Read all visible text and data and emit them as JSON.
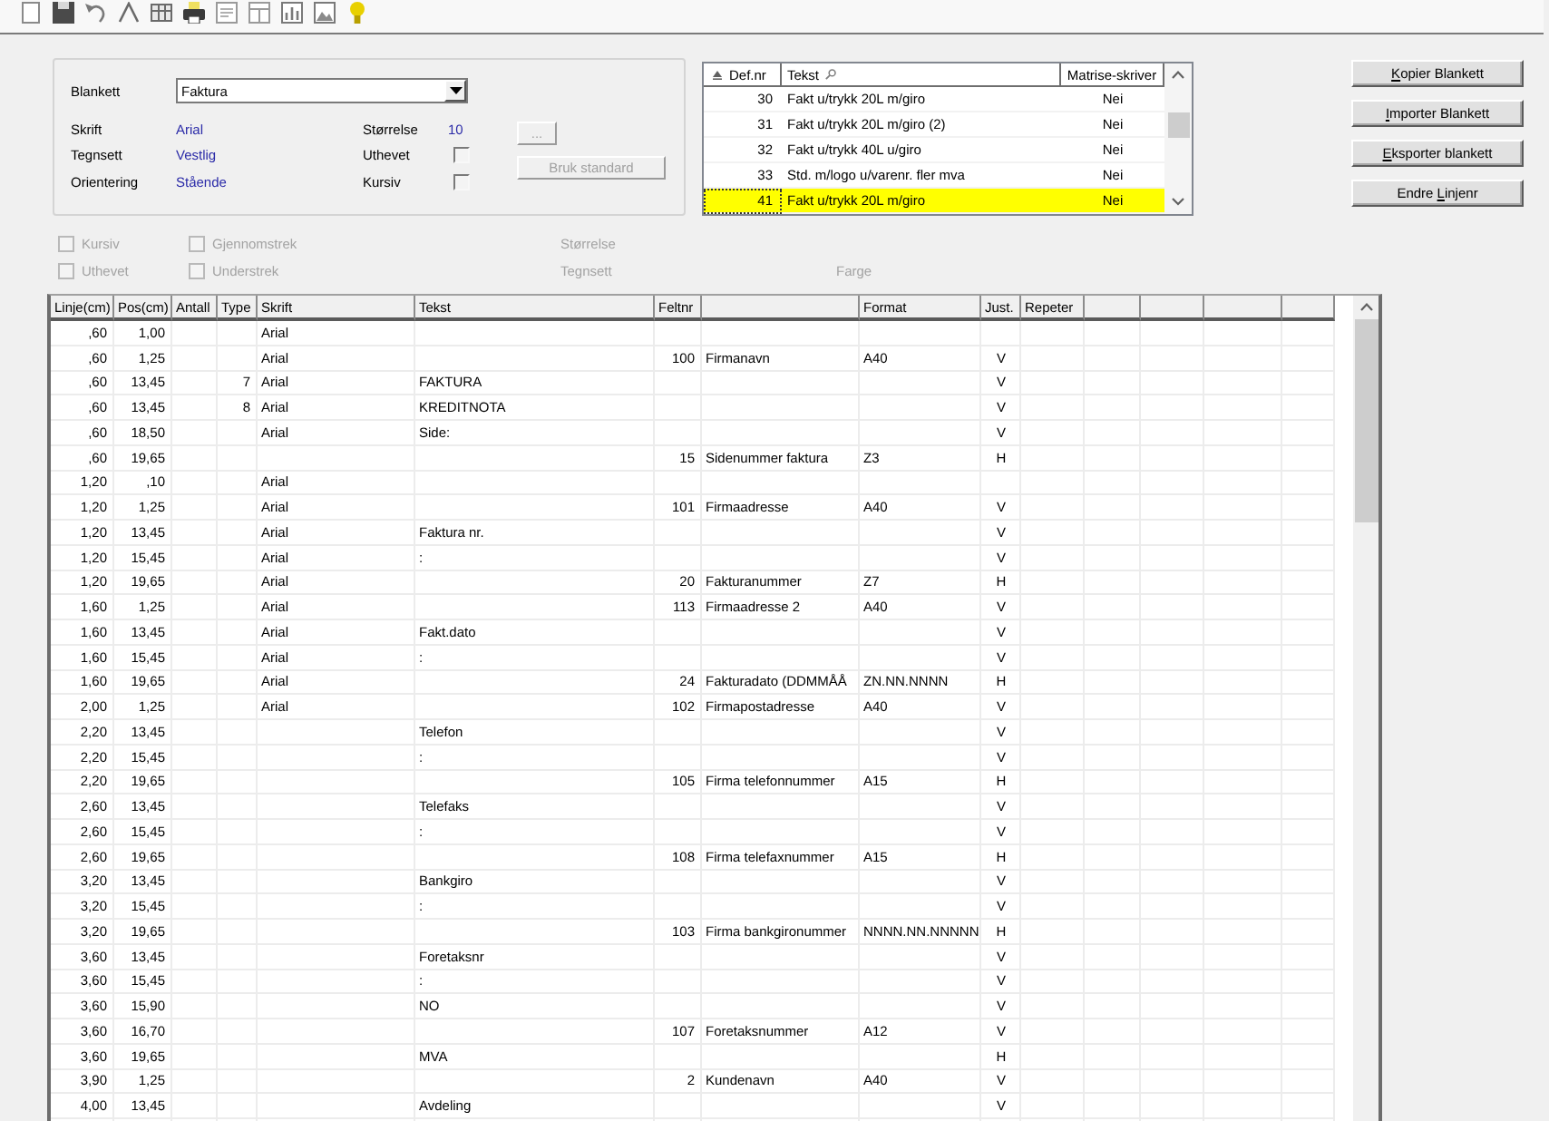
{
  "form_settings": {
    "blankett": {
      "label": "Blankett",
      "value": "Faktura"
    },
    "rows": [
      [
        {
          "kind": "value",
          "label": "Skrift",
          "value": "Arial"
        },
        {
          "kind": "value",
          "label": "Størrelse",
          "value": "10"
        }
      ],
      [
        {
          "kind": "value",
          "label": "Tegnsett",
          "value": "Vestlig"
        },
        {
          "kind": "checkbox",
          "label": "Uthevet",
          "checked": false
        }
      ],
      [
        {
          "kind": "value",
          "label": "Orientering",
          "value": "Stående"
        },
        {
          "kind": "checkbox",
          "label": "Kursiv",
          "checked": false
        }
      ]
    ],
    "buttons": [
      {
        "label": "...",
        "disabled": true
      },
      {
        "label": "Bruk standard",
        "disabled": true
      }
    ]
  },
  "form_list": {
    "columns": [
      {
        "label": "Def.nr",
        "sorted_ascending": true
      },
      {
        "label": "Tekst",
        "searchable": true
      },
      {
        "label": "Matrise-skriver"
      }
    ],
    "rows": [
      {
        "cells": [
          "30",
          "Fakt u/trykk 20L m/giro",
          "Nei"
        ],
        "selected": false
      },
      {
        "cells": [
          "31",
          "Fakt u/trykk 20L m/giro (2)",
          "Nei"
        ],
        "selected": false
      },
      {
        "cells": [
          "32",
          "Fakt u/trykk 40L u/giro",
          "Nei"
        ],
        "selected": false
      },
      {
        "cells": [
          "33",
          "Std. m/logo u/varenr. fler mva",
          "Nei"
        ],
        "selected": false
      },
      {
        "cells": [
          "41",
          "Fakt u/trykk 20L m/giro",
          "Nei"
        ],
        "selected": true
      }
    ]
  },
  "actions": [
    {
      "label": "Kopier Blankett",
      "mnemonic_in_second_word": false
    },
    {
      "label": "Importer Blankett",
      "mnemonic_in_second_word": false
    },
    {
      "label": "Eksporter blankett",
      "mnemonic_in_second_word": false
    },
    {
      "label": "Endre Linjenr",
      "mnemonic_in_second_word": true
    }
  ],
  "field_options": [
    [
      {
        "kind": "checkbox",
        "label": "Kursiv",
        "checked": false,
        "disabled": true
      },
      {
        "kind": "checkbox",
        "label": "Gjennomstrek",
        "checked": false,
        "disabled": true
      },
      {
        "kind": "label",
        "text": "Størrelse",
        "disabled": true
      }
    ],
    [
      {
        "kind": "checkbox",
        "label": "Uthevet",
        "checked": false,
        "disabled": true
      },
      {
        "kind": "checkbox",
        "label": "Understrek",
        "checked": false,
        "disabled": true
      },
      {
        "kind": "label",
        "text": "Tegnsett",
        "disabled": true
      },
      {
        "kind": "label",
        "text": "Farge",
        "disabled": true
      }
    ]
  ],
  "grid": {
    "columns": [
      "Linje(cm)",
      "Pos(cm)",
      "Antall",
      "Type",
      "Skrift",
      "Tekst",
      "Feltnr",
      null,
      "Format",
      "Just.",
      "Repeter",
      null,
      null,
      null,
      null
    ],
    "rows": [
      [
        ",60",
        "1,00",
        null,
        null,
        "Arial"
      ],
      [
        ",60",
        "1,25",
        null,
        null,
        "Arial",
        null,
        "100",
        "Firmanavn",
        "A40",
        "V"
      ],
      [
        ",60",
        "13,45",
        null,
        "7",
        "Arial",
        "FAKTURA",
        null,
        null,
        null,
        "V"
      ],
      [
        ",60",
        "13,45",
        null,
        "8",
        "Arial",
        "KREDITNOTA",
        null,
        null,
        null,
        "V"
      ],
      [
        ",60",
        "18,50",
        null,
        null,
        "Arial",
        "Side:",
        null,
        null,
        null,
        "V"
      ],
      [
        ",60",
        "19,65",
        null,
        null,
        null,
        null,
        "15",
        "Sidenummer faktura",
        "Z3",
        "H"
      ],
      [
        "1,20",
        ",10",
        null,
        null,
        "Arial"
      ],
      [
        "1,20",
        "1,25",
        null,
        null,
        "Arial",
        null,
        "101",
        "Firmaadresse",
        "A40",
        "V"
      ],
      [
        "1,20",
        "13,45",
        null,
        null,
        "Arial",
        "Faktura nr.",
        null,
        null,
        null,
        "V"
      ],
      [
        "1,20",
        "15,45",
        null,
        null,
        "Arial",
        ":",
        null,
        null,
        null,
        "V"
      ],
      [
        "1,20",
        "19,65",
        null,
        null,
        "Arial",
        null,
        "20",
        "Fakturanummer",
        "Z7",
        "H"
      ],
      [
        "1,60",
        "1,25",
        null,
        null,
        "Arial",
        null,
        "113",
        "Firmaadresse 2",
        "A40",
        "V"
      ],
      [
        "1,60",
        "13,45",
        null,
        null,
        "Arial",
        "Fakt.dato",
        null,
        null,
        null,
        "V"
      ],
      [
        "1,60",
        "15,45",
        null,
        null,
        "Arial",
        ":",
        null,
        null,
        null,
        "V"
      ],
      [
        "1,60",
        "19,65",
        null,
        null,
        "Arial",
        null,
        "24",
        "Fakturadato (DDMMÅÅ",
        "ZN.NN.NNNN",
        "H"
      ],
      [
        "2,00",
        "1,25",
        null,
        null,
        "Arial",
        null,
        "102",
        "Firmapostadresse",
        "A40",
        "V"
      ],
      [
        "2,20",
        "13,45",
        null,
        null,
        null,
        "Telefon",
        null,
        null,
        null,
        "V"
      ],
      [
        "2,20",
        "15,45",
        null,
        null,
        null,
        ":",
        null,
        null,
        null,
        "V"
      ],
      [
        "2,20",
        "19,65",
        null,
        null,
        null,
        null,
        "105",
        "Firma telefonnummer",
        "A15",
        "H"
      ],
      [
        "2,60",
        "13,45",
        null,
        null,
        null,
        "Telefaks",
        null,
        null,
        null,
        "V"
      ],
      [
        "2,60",
        "15,45",
        null,
        null,
        null,
        ":",
        null,
        null,
        null,
        "V"
      ],
      [
        "2,60",
        "19,65",
        null,
        null,
        null,
        null,
        "108",
        "Firma telefaxnummer",
        "A15",
        "H"
      ],
      [
        "3,20",
        "13,45",
        null,
        null,
        null,
        "Bankgiro",
        null,
        null,
        null,
        "V"
      ],
      [
        "3,20",
        "15,45",
        null,
        null,
        null,
        ":",
        null,
        null,
        null,
        "V"
      ],
      [
        "3,20",
        "19,65",
        null,
        null,
        null,
        null,
        "103",
        "Firma bankgironummer",
        "NNNN.NN.NNNNN",
        "H"
      ],
      [
        "3,60",
        "13,45",
        null,
        null,
        null,
        "Foretaksnr",
        null,
        null,
        null,
        "V"
      ],
      [
        "3,60",
        "15,45",
        null,
        null,
        null,
        ":",
        null,
        null,
        null,
        "V"
      ],
      [
        "3,60",
        "15,90",
        null,
        null,
        null,
        "NO",
        null,
        null,
        null,
        "V"
      ],
      [
        "3,60",
        "16,70",
        null,
        null,
        null,
        null,
        "107",
        "Foretaksnummer",
        "A12",
        "V"
      ],
      [
        "3,60",
        "19,65",
        null,
        null,
        null,
        "MVA",
        null,
        null,
        null,
        "H"
      ],
      [
        "3,90",
        "1,25",
        null,
        null,
        null,
        null,
        "2",
        "Kundenavn",
        "A40",
        "V"
      ],
      [
        "4,00",
        "13,45",
        null,
        null,
        null,
        "Avdeling",
        null,
        null,
        null,
        "V"
      ]
    ]
  }
}
